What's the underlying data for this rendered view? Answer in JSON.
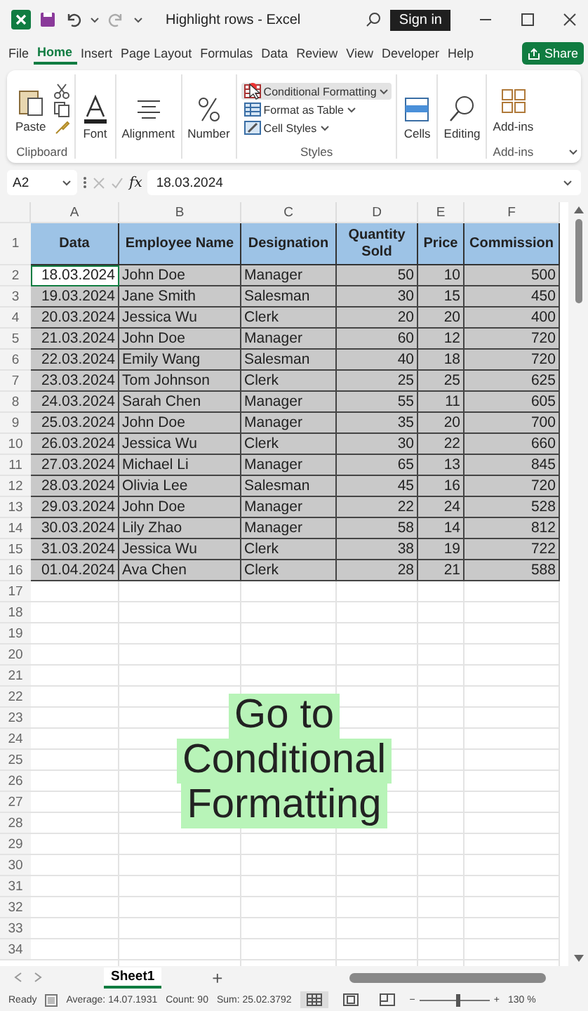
{
  "title_bar": {
    "title": "Highlight rows  -  Excel",
    "sign_in": "Sign in"
  },
  "ribbon_tabs": [
    {
      "label": "File",
      "selected": false
    },
    {
      "label": "Home",
      "selected": true
    },
    {
      "label": "Insert",
      "selected": false
    },
    {
      "label": "Page Layout",
      "selected": false
    },
    {
      "label": "Formulas",
      "selected": false
    },
    {
      "label": "Data",
      "selected": false
    },
    {
      "label": "Review",
      "selected": false
    },
    {
      "label": "View",
      "selected": false
    },
    {
      "label": "Developer",
      "selected": false
    },
    {
      "label": "Help",
      "selected": false
    }
  ],
  "share_button": "Share",
  "ribbon": {
    "clipboard": {
      "paste": "Paste",
      "label": "Clipboard"
    },
    "font": "Font",
    "alignment": "Alignment",
    "number": "Number",
    "styles": {
      "label": "Styles",
      "buttons": [
        {
          "kind": "conditional",
          "label": "Conditional Formatting",
          "hovered": true
        },
        {
          "kind": "table",
          "label": "Format as Table",
          "hovered": false
        },
        {
          "kind": "styles",
          "label": "Cell Styles",
          "hovered": false
        }
      ]
    },
    "cells": "Cells",
    "editing": "Editing",
    "addins": {
      "button": "Add-ins",
      "label": "Add-ins"
    }
  },
  "formula_bar": {
    "name_box": "A2",
    "fx": "fx",
    "value": "18.03.2024"
  },
  "sheet": {
    "columns": [
      {
        "letter": "A",
        "kind": "number"
      },
      {
        "letter": "B",
        "kind": "text"
      },
      {
        "letter": "C",
        "kind": "text"
      },
      {
        "letter": "D",
        "kind": "number"
      },
      {
        "letter": "E",
        "kind": "number"
      },
      {
        "letter": "F",
        "kind": "number"
      }
    ],
    "header_row": {
      "number": "1",
      "cells": [
        "Data",
        "Employee Name",
        "Designation",
        "Quantity Sold",
        "Price",
        "Commission"
      ]
    },
    "rows": [
      {
        "number": "2",
        "selected": true,
        "active": true,
        "cells": [
          "18.03.2024",
          "John Doe",
          "Manager",
          "50",
          "10",
          "500"
        ]
      },
      {
        "number": "3",
        "selected": true,
        "active": false,
        "cells": [
          "19.03.2024",
          "Jane Smith",
          "Salesman",
          "30",
          "15",
          "450"
        ]
      },
      {
        "number": "4",
        "selected": true,
        "active": false,
        "cells": [
          "20.03.2024",
          "Jessica Wu",
          "Clerk",
          "20",
          "20",
          "400"
        ]
      },
      {
        "number": "5",
        "selected": true,
        "active": false,
        "cells": [
          "21.03.2024",
          "John Doe",
          "Manager",
          "60",
          "12",
          "720"
        ]
      },
      {
        "number": "6",
        "selected": true,
        "active": false,
        "cells": [
          "22.03.2024",
          "Emily Wang",
          "Salesman",
          "40",
          "18",
          "720"
        ]
      },
      {
        "number": "7",
        "selected": true,
        "active": false,
        "cells": [
          "23.03.2024",
          "Tom Johnson",
          "Clerk",
          "25",
          "25",
          "625"
        ]
      },
      {
        "number": "8",
        "selected": true,
        "active": false,
        "cells": [
          "24.03.2024",
          "Sarah Chen",
          "Manager",
          "55",
          "11",
          "605"
        ]
      },
      {
        "number": "9",
        "selected": true,
        "active": false,
        "cells": [
          "25.03.2024",
          "John Doe",
          "Manager",
          "35",
          "20",
          "700"
        ]
      },
      {
        "number": "10",
        "selected": true,
        "active": false,
        "cells": [
          "26.03.2024",
          "Jessica Wu",
          "Clerk",
          "30",
          "22",
          "660"
        ]
      },
      {
        "number": "11",
        "selected": true,
        "active": false,
        "cells": [
          "27.03.2024",
          "Michael Li",
          "Manager",
          "65",
          "13",
          "845"
        ]
      },
      {
        "number": "12",
        "selected": true,
        "active": false,
        "cells": [
          "28.03.2024",
          "Olivia Lee",
          "Salesman",
          "45",
          "16",
          "720"
        ]
      },
      {
        "number": "13",
        "selected": true,
        "active": false,
        "cells": [
          "29.03.2024",
          "John Doe",
          "Manager",
          "22",
          "24",
          "528"
        ]
      },
      {
        "number": "14",
        "selected": true,
        "active": false,
        "cells": [
          "30.03.2024",
          "Lily Zhao",
          "Manager",
          "58",
          "14",
          "812"
        ]
      },
      {
        "number": "15",
        "selected": true,
        "active": false,
        "cells": [
          "31.03.2024",
          "Jessica Wu",
          "Clerk",
          "38",
          "19",
          "722"
        ]
      },
      {
        "number": "16",
        "selected": true,
        "active": false,
        "cells": [
          "01.04.2024",
          "Ava Chen",
          "Clerk",
          "28",
          "21",
          "588"
        ]
      }
    ],
    "empty_rows": [
      "17",
      "18",
      "19",
      "20",
      "21",
      "22",
      "23",
      "24",
      "25",
      "26",
      "27",
      "28",
      "29",
      "30",
      "31",
      "32",
      "33",
      "34"
    ]
  },
  "caption": {
    "lines": [
      "Go to",
      "Conditional",
      "Formatting"
    ]
  },
  "sheet_tabs": [
    {
      "label": "Sheet1",
      "selected": true
    }
  ],
  "add_sheet": "+",
  "status_bar": {
    "status": "Ready",
    "average": "Average: 14.07.1931",
    "count": "Count: 90",
    "sum": "Sum: 25.02.3792",
    "views": [
      {
        "kind": "normal",
        "selected": true
      },
      {
        "kind": "page_layout",
        "selected": false
      },
      {
        "kind": "page_break",
        "selected": false
      }
    ],
    "zoom": {
      "zoom_out": "−",
      "zoom_in": "+",
      "level": 0.55,
      "reading": "130 %"
    }
  }
}
